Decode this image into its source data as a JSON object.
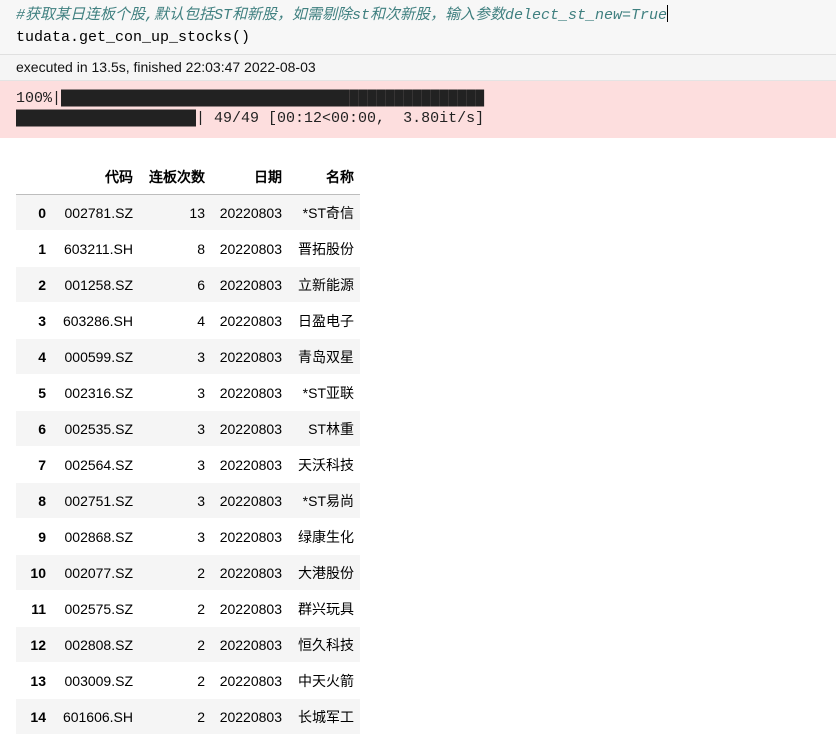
{
  "cell": {
    "comment": "#获取某日连板个股,默认包括ST和新股，如需剔除st和次新股，输入参数delect_st_new=True",
    "code": "tudata.get_con_up_stocks()"
  },
  "status": {
    "executed_text": "executed in 13.5s, finished 22:03:47 2022-08-03"
  },
  "progress": {
    "percent_label": "100%|",
    "stats": "| 49/49 [00:12<00:00,  3.80it/s]",
    "fraction": 1.0,
    "bar_char": "█",
    "line1_blocks": 47,
    "line2_blocks": 20
  },
  "table": {
    "columns": [
      "",
      "代码",
      "连板次数",
      "日期",
      "名称"
    ],
    "rows": [
      [
        "0",
        "002781.SZ",
        "13",
        "20220803",
        "*ST奇信"
      ],
      [
        "1",
        "603211.SH",
        "8",
        "20220803",
        "晋拓股份"
      ],
      [
        "2",
        "001258.SZ",
        "6",
        "20220803",
        "立新能源"
      ],
      [
        "3",
        "603286.SH",
        "4",
        "20220803",
        "日盈电子"
      ],
      [
        "4",
        "000599.SZ",
        "3",
        "20220803",
        "青岛双星"
      ],
      [
        "5",
        "002316.SZ",
        "3",
        "20220803",
        "*ST亚联"
      ],
      [
        "6",
        "002535.SZ",
        "3",
        "20220803",
        "ST林重"
      ],
      [
        "7",
        "002564.SZ",
        "3",
        "20220803",
        "天沃科技"
      ],
      [
        "8",
        "002751.SZ",
        "3",
        "20220803",
        "*ST易尚"
      ],
      [
        "9",
        "002868.SZ",
        "3",
        "20220803",
        "绿康生化"
      ],
      [
        "10",
        "002077.SZ",
        "2",
        "20220803",
        "大港股份"
      ],
      [
        "11",
        "002575.SZ",
        "2",
        "20220803",
        "群兴玩具"
      ],
      [
        "12",
        "002808.SZ",
        "2",
        "20220803",
        "恒久科技"
      ],
      [
        "13",
        "003009.SZ",
        "2",
        "20220803",
        "中天火箭"
      ],
      [
        "14",
        "601606.SH",
        "2",
        "20220803",
        "长城军工"
      ]
    ]
  }
}
